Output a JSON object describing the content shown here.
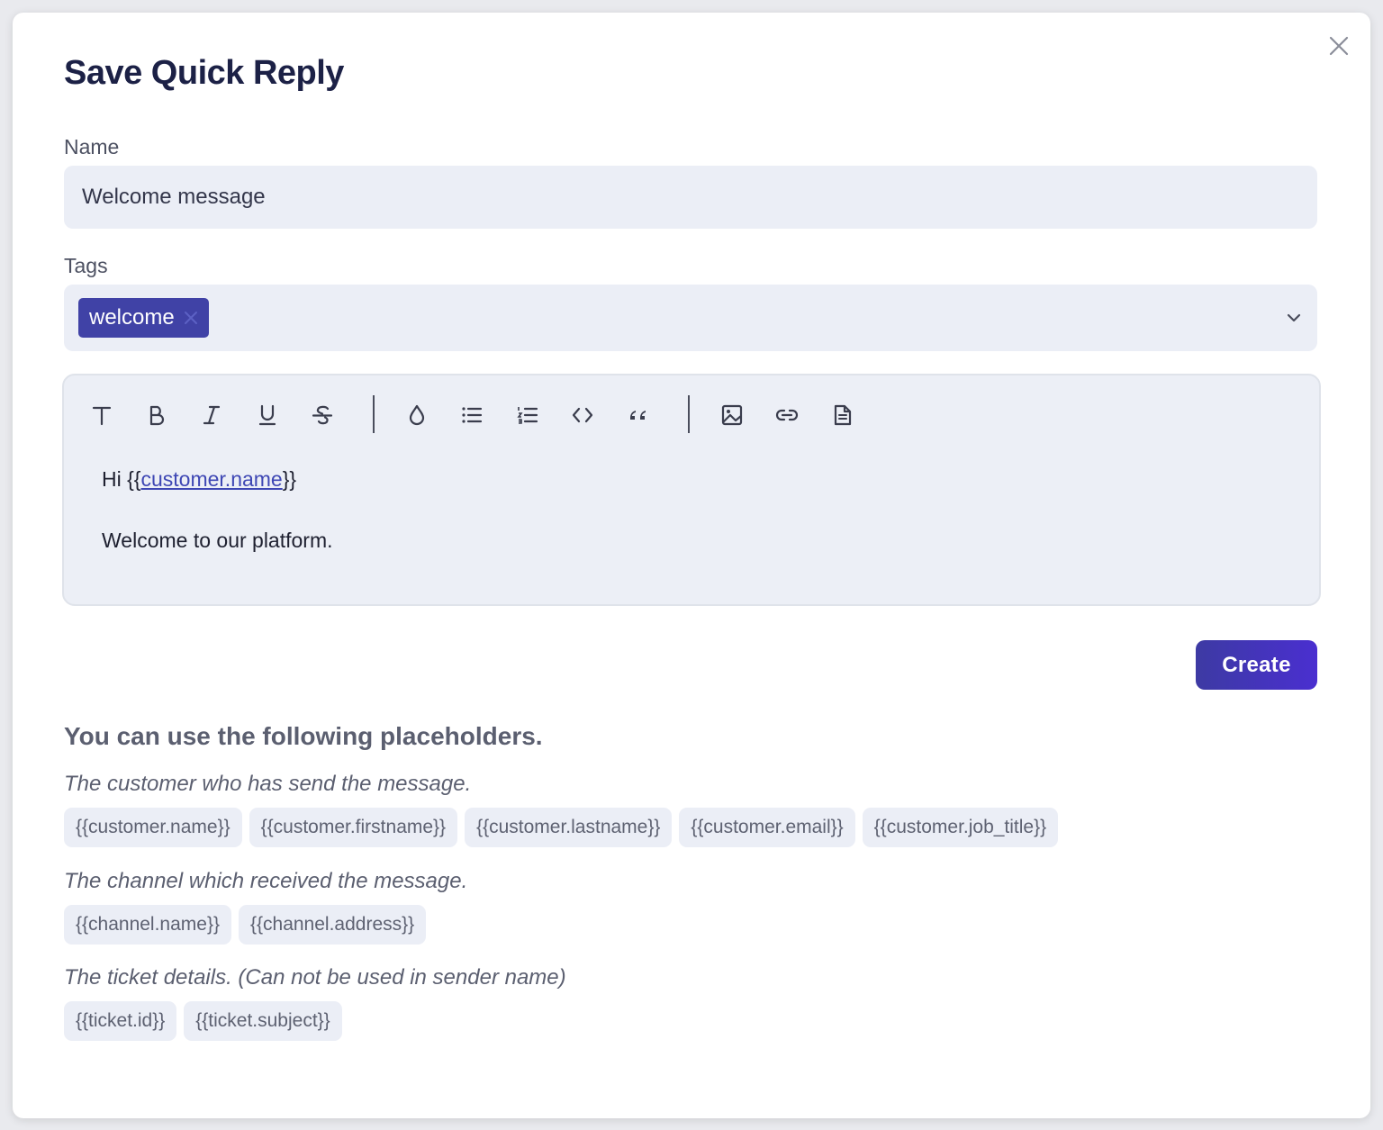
{
  "modal": {
    "title": "Save Quick Reply"
  },
  "form": {
    "name_label": "Name",
    "name_value": "Welcome message",
    "tags_label": "Tags",
    "tags": [
      "welcome"
    ]
  },
  "editor": {
    "toolbar": [
      "text-style-icon",
      "bold-icon",
      "italic-icon",
      "underline-icon",
      "strikethrough-icon",
      "color-drop-icon",
      "bullet-list-icon",
      "numbered-list-icon",
      "code-icon",
      "quote-icon",
      "image-icon",
      "link-icon",
      "document-icon"
    ],
    "line1_prefix": "Hi {{",
    "line1_link": "customer.name",
    "line1_suffix": "}}",
    "line2": "Welcome to our platform."
  },
  "actions": {
    "create_label": "Create"
  },
  "placeholders": {
    "heading": "You can use the following placeholders.",
    "groups": [
      {
        "title": "The customer who has send the message.",
        "items": [
          "{{customer.name}}",
          "{{customer.firstname}}",
          "{{customer.lastname}}",
          "{{customer.email}}",
          "{{customer.job_title}}"
        ]
      },
      {
        "title": "The channel which received the message.",
        "items": [
          "{{channel.name}}",
          "{{channel.address}}"
        ]
      },
      {
        "title": "The ticket details. (Can not be used in sender name)",
        "items": [
          "{{ticket.id}}",
          "{{ticket.subject}}"
        ]
      }
    ]
  },
  "colors": {
    "accent": "#4042a6",
    "title": "#1c2146",
    "field_bg": "#ebeef6"
  }
}
